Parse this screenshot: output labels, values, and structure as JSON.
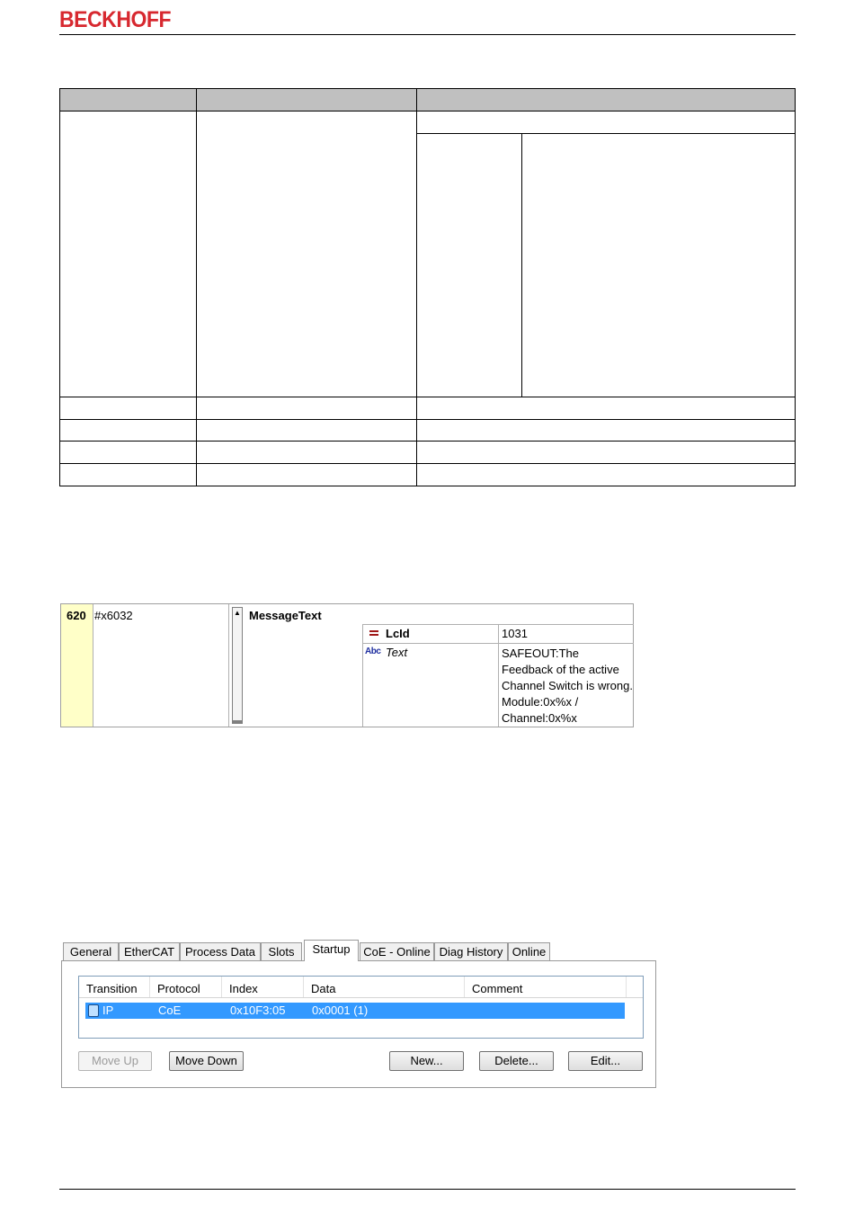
{
  "header": {
    "brand": "BECKHOFF"
  },
  "message_dialog": {
    "number": "620",
    "index": "#x6032",
    "title": "MessageText",
    "rows": [
      {
        "name": "LcId",
        "value": "1031"
      },
      {
        "name": "Text",
        "value": "SAFEOUT:The Feedback of the active Channel Switch is wrong. Module:0x%x / Channel:0x%x"
      }
    ]
  },
  "startup_panel": {
    "tabs": [
      "General",
      "EtherCAT",
      "Process Data",
      "Slots",
      "Startup",
      "CoE - Online",
      "Diag History",
      "Online"
    ],
    "active_tab": "Startup",
    "columns": [
      "Transition",
      "Protocol",
      "Index",
      "Data",
      "Comment"
    ],
    "rows": [
      {
        "transition": "IP",
        "protocol": "CoE",
        "index": "0x10F3:05",
        "data": "0x0001 (1)",
        "comment": ""
      }
    ],
    "buttons": {
      "move_up": "Move Up",
      "move_down": "Move Down",
      "new": "New...",
      "delete": "Delete...",
      "edit": "Edit..."
    }
  },
  "colors": {
    "brand": "#d7282f",
    "selection": "#3399ff",
    "index_highlight": "#ffffc8"
  }
}
